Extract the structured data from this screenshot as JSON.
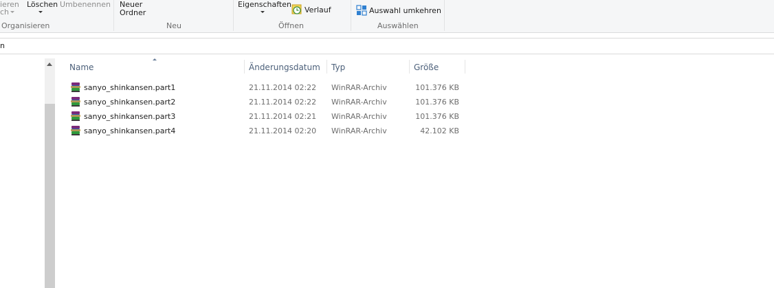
{
  "ribbon": {
    "organize": {
      "copy_path_partial_1": "ieren",
      "copy_path_partial_2": "ch",
      "delete_label": "Löschen",
      "rename_label": "Umbenennen",
      "group_label": "Organisieren"
    },
    "new": {
      "new_folder_line1": "Neuer",
      "new_folder_line2": "Ordner",
      "group_label": "Neu"
    },
    "open": {
      "properties_label": "Eigenschaften",
      "history_label": "Verlauf",
      "group_label": "Öffnen"
    },
    "select": {
      "invert_selection_label": "Auswahl umkehren",
      "group_label": "Auswählen"
    }
  },
  "address": {
    "text": "n"
  },
  "columns": {
    "name": "Name",
    "date": "Änderungsdatum",
    "type": "Typ",
    "size": "Größe"
  },
  "files": [
    {
      "name": "sanyo_shinkansen.part1",
      "date": "21.11.2014 02:22",
      "type": "WinRAR-Archiv",
      "size": "101.376 KB"
    },
    {
      "name": "sanyo_shinkansen.part2",
      "date": "21.11.2014 02:22",
      "type": "WinRAR-Archiv",
      "size": "101.376 KB"
    },
    {
      "name": "sanyo_shinkansen.part3",
      "date": "21.11.2014 02:21",
      "type": "WinRAR-Archiv",
      "size": "101.376 KB"
    },
    {
      "name": "sanyo_shinkansen.part4",
      "date": "21.11.2014 02:20",
      "type": "WinRAR-Archiv",
      "size": "42.102 KB"
    }
  ],
  "colors": {
    "ribbon_bg": "#f5f6f7",
    "header_text": "#4c607a",
    "accent_blue": "#2f80d1"
  },
  "icons": {
    "archive": "winrar-archive-icon",
    "history": "history-icon",
    "invert_selection": "invert-selection-icon",
    "sort": "sort-ascending-icon"
  }
}
